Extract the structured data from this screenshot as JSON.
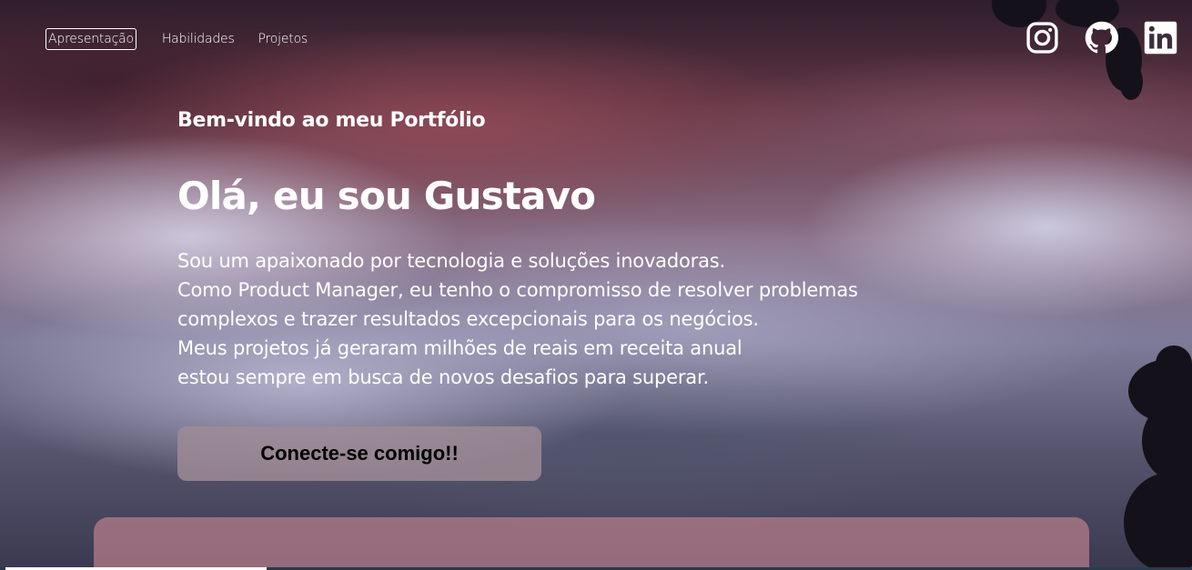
{
  "nav": {
    "items": [
      {
        "label": "Apresentação",
        "active": true
      },
      {
        "label": "Habilidades",
        "active": false
      },
      {
        "label": "Projetos",
        "active": false
      }
    ]
  },
  "social": {
    "icons": [
      "instagram-icon",
      "github-icon",
      "linkedin-icon"
    ],
    "color": "#ffffff"
  },
  "hero": {
    "welcome": "Bem-vindo ao meu Portfólio",
    "title": "Olá, eu sou Gustavo",
    "description": [
      "Sou um apaixonado por tecnologia e soluções inovadoras.",
      "Como Product Manager, eu tenho o compromisso de resolver problemas",
      "complexos e trazer resultados excepcionais para os negócios.",
      "Meus projetos já geraram milhões de reais em receita anual",
      "estou sempre em busca de novos desafios para superar."
    ],
    "cta_label": "Conecte-se comigo!!"
  },
  "colors": {
    "text": "#ffffff",
    "cta_bg": "#a08c96",
    "panel_bg": "#b8808c"
  }
}
